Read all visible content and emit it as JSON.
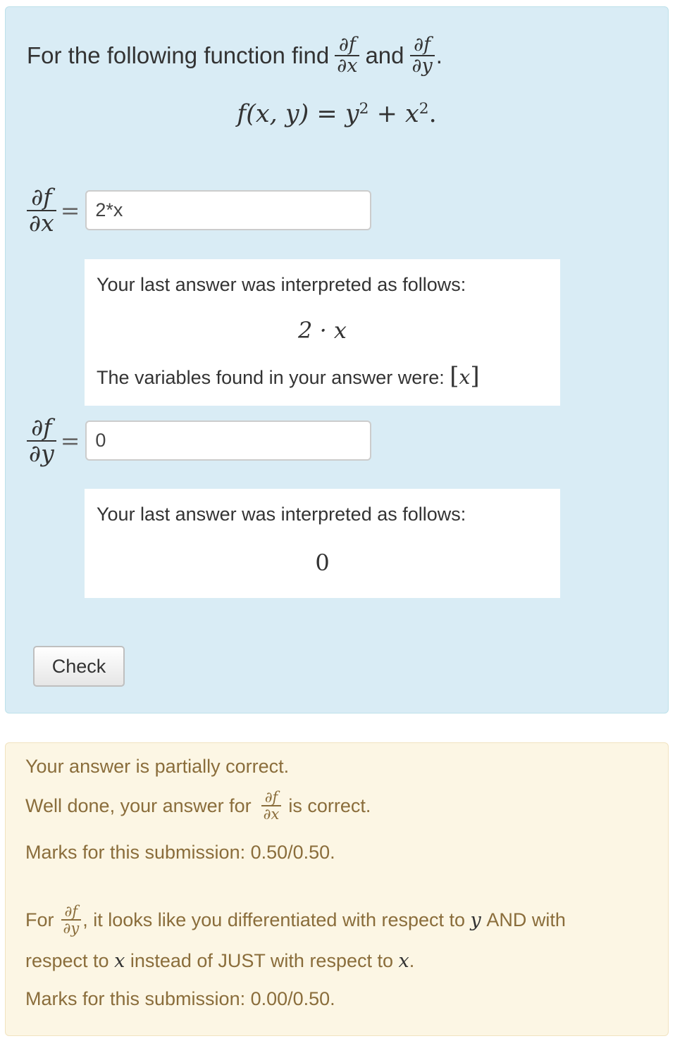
{
  "question": {
    "prompt_prefix": "For the following function find",
    "prompt_and": "and",
    "prompt_end": ".",
    "df": "∂f",
    "dx": "∂x",
    "dy": "∂y",
    "equation": {
      "lhs": "f(x, y) = y",
      "mid": " + x",
      "exp": "2",
      "end": "."
    }
  },
  "answers": [
    {
      "num": "∂f",
      "den": "∂x",
      "equals": "=",
      "value": "2*x",
      "interp_label": "Your last answer was interpreted as follows:",
      "interp_value": "2 · x",
      "vars_label": "The variables found in your answer were:",
      "vars_value": "x"
    },
    {
      "num": "∂f",
      "den": "∂y",
      "equals": "=",
      "value": "0",
      "interp_label": "Your last answer was interpreted as follows:",
      "interp_value": "0"
    }
  ],
  "check_button": "Check",
  "feedback": {
    "summary": "Your answer is partially correct.",
    "well_done_prefix": "Well done, your answer for",
    "well_done_suffix": "is correct.",
    "marks1": "Marks for this submission: 0.50/0.50.",
    "for_prefix": "For",
    "for_text": ", it looks like you differentiated with respect to",
    "var_y": "y",
    "and_with": "AND with",
    "respect_to": "respect to",
    "var_x": "x",
    "instead": "instead of JUST with respect to",
    "var_x2": "x",
    "period": ".",
    "marks2": "Marks for this submission: 0.00/0.50."
  },
  "colors": {
    "question_bg": "#d9ecf5",
    "feedback_bg": "#fcf6e4",
    "feedback_text": "#8a6d3b"
  }
}
